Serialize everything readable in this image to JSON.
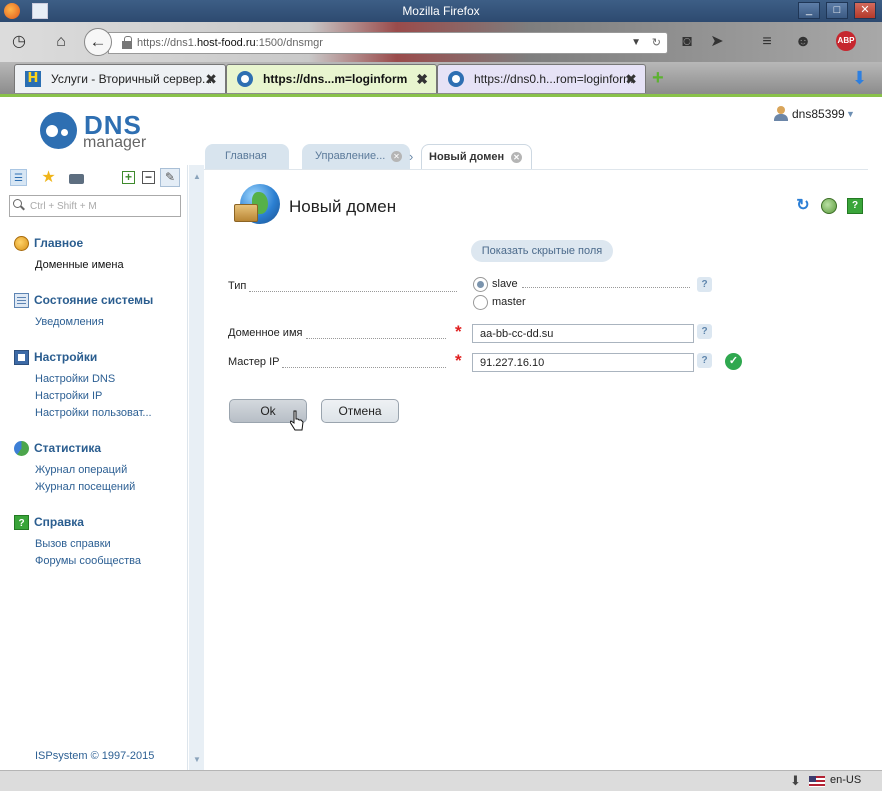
{
  "browser": {
    "window_title": "Mozilla Firefox",
    "url_prefix": "https://dns1.",
    "url_host": "host-food.ru",
    "url_suffix": ":1500/dnsmgr",
    "tabs": [
      {
        "label": "Услуги - Вторичный сервер...",
        "active": false
      },
      {
        "label": "https://dns...m=loginform",
        "active": true
      },
      {
        "label": "https://dns0.h...rom=loginform",
        "active": false
      }
    ],
    "locale": "en-US"
  },
  "app": {
    "logo_main": "DNS",
    "logo_sub": "manager",
    "user": "dns85399",
    "tabs": [
      {
        "label": "Главная"
      },
      {
        "label": "Управление..."
      },
      {
        "label": "Новый домен"
      }
    ]
  },
  "sidebar": {
    "search_placeholder": "Ctrl + Shift + M",
    "groups": [
      {
        "title": "Главное",
        "items": [
          "Доменные имена"
        ]
      },
      {
        "title": "Состояние системы",
        "items": [
          "Уведомления"
        ]
      },
      {
        "title": "Настройки",
        "items": [
          "Настройки DNS",
          "Настройки IP",
          "Настройки пользоват..."
        ]
      },
      {
        "title": "Статистика",
        "items": [
          "Журнал операций",
          "Журнал посещений"
        ]
      },
      {
        "title": "Справка",
        "items": [
          "Вызов справки",
          "Форумы сообщества"
        ]
      }
    ],
    "footer": "ISPsystem © 1997-2015"
  },
  "form": {
    "title": "Новый домен",
    "show_hidden_label": "Показать скрытые поля",
    "type_label": "Тип",
    "type_options": [
      "slave",
      "master"
    ],
    "type_selected": "slave",
    "domain_label": "Доменное имя",
    "domain_value": "aa-bb-cc-dd.su",
    "master_ip_label": "Мастер IP",
    "master_ip_value": "91.227.16.10",
    "help_glyph": "?",
    "ok_label": "Ok",
    "cancel_label": "Отмена"
  },
  "colors": {
    "accent": "#2e6fb2",
    "active_tab_stripe": "#89c24a",
    "required": "#e02020",
    "valid": "#2fa84f"
  }
}
